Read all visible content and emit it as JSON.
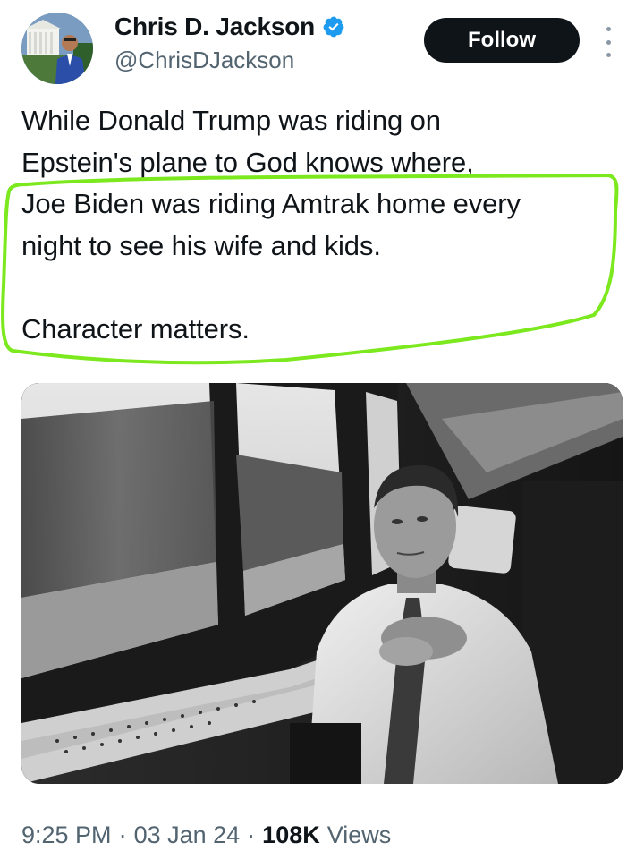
{
  "author": {
    "display_name": "Chris D. Jackson",
    "handle": "@ChrisDJackson",
    "verified": true
  },
  "actions": {
    "follow_label": "Follow"
  },
  "tweet": {
    "lines": [
      "While Donald Trump was riding on",
      "Epstein's plane to God knows where,",
      "Joe Biden was riding Amtrak home every",
      "night to see his wife and kids.",
      "",
      "Character matters."
    ],
    "highlight_color": "#7ce81e"
  },
  "meta": {
    "time": "9:25 PM",
    "separator": "·",
    "date": "03 Jan 24",
    "views_count": "108K",
    "views_label": "Views"
  },
  "colors": {
    "verified_badge": "#1d9bf0",
    "follow_button_bg": "#0f1419",
    "secondary_text": "#536471"
  }
}
